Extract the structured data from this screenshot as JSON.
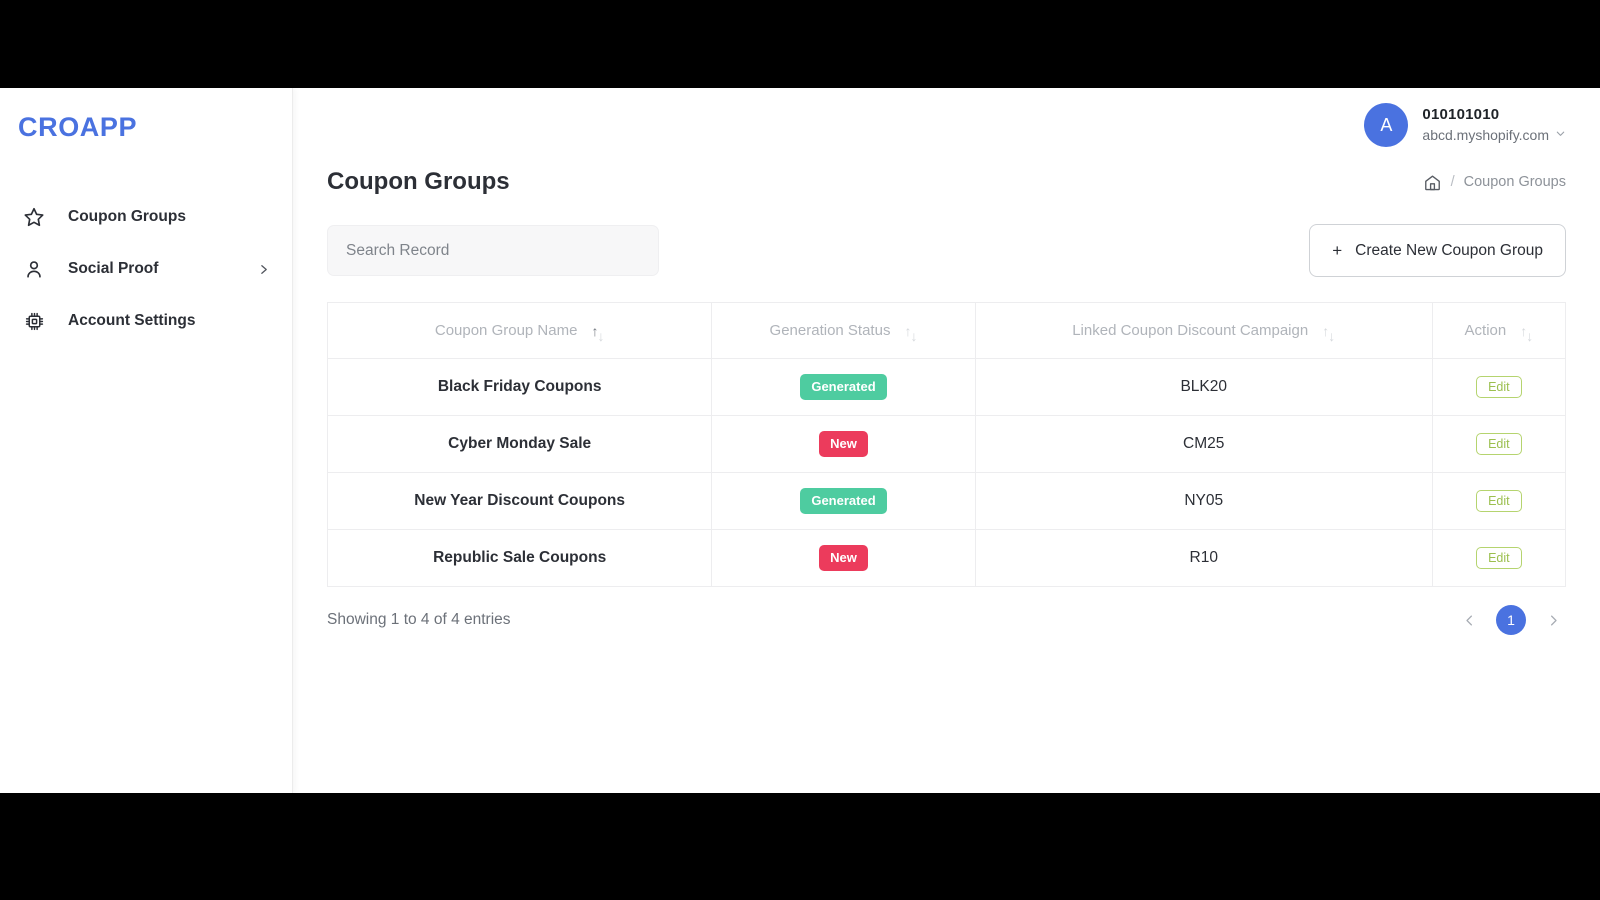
{
  "brand": {
    "name": "CROAPP",
    "color": "#4A72E0"
  },
  "sidebar": {
    "items": [
      {
        "label": "Coupon Groups",
        "icon": "star-icon",
        "has_chevron": false
      },
      {
        "label": "Social Proof",
        "icon": "user-icon",
        "has_chevron": true
      },
      {
        "label": "Account Settings",
        "icon": "chip-icon",
        "has_chevron": false
      }
    ]
  },
  "account": {
    "avatar_initial": "A",
    "name": "010101010",
    "domain": "abcd.myshopify.com",
    "caret_icon": "chevron-down-icon"
  },
  "header": {
    "title": "Coupon Groups",
    "breadcrumb": {
      "home_icon": "home-icon",
      "separator": "/",
      "current": "Coupon Groups"
    }
  },
  "toolbar": {
    "search_placeholder": "Search Record",
    "search_value": "",
    "create_label": "Create New Coupon Group",
    "create_plus": "+"
  },
  "table": {
    "columns": [
      {
        "label": "Coupon Group Name",
        "sort": "asc"
      },
      {
        "label": "Generation Status",
        "sort": "none"
      },
      {
        "label": "Linked Coupon Discount Campaign",
        "sort": "none"
      },
      {
        "label": "Action",
        "sort": "none"
      }
    ],
    "rows": [
      {
        "name": "Black Friday Coupons",
        "status": "Generated",
        "status_kind": "generated",
        "campaign": "BLK20",
        "action": "Edit"
      },
      {
        "name": "Cyber Monday Sale",
        "status": "New",
        "status_kind": "new",
        "campaign": "CM25",
        "action": "Edit"
      },
      {
        "name": "New Year Discount Coupons",
        "status": "Generated",
        "status_kind": "generated",
        "campaign": "NY05",
        "action": "Edit"
      },
      {
        "name": "Republic Sale Coupons",
        "status": "New",
        "status_kind": "new",
        "campaign": "R10",
        "action": "Edit"
      }
    ]
  },
  "footer": {
    "entries_info": "Showing 1 to 4 of 4 entries",
    "prev_icon": "chevron-left-icon",
    "next_icon": "chevron-right-icon",
    "current_page": "1"
  },
  "colors": {
    "accent_blue": "#4A72E0",
    "badge_generated": "#4ECCA0",
    "badge_new": "#EC3B5C",
    "edit_green": "#A8CC5C"
  }
}
